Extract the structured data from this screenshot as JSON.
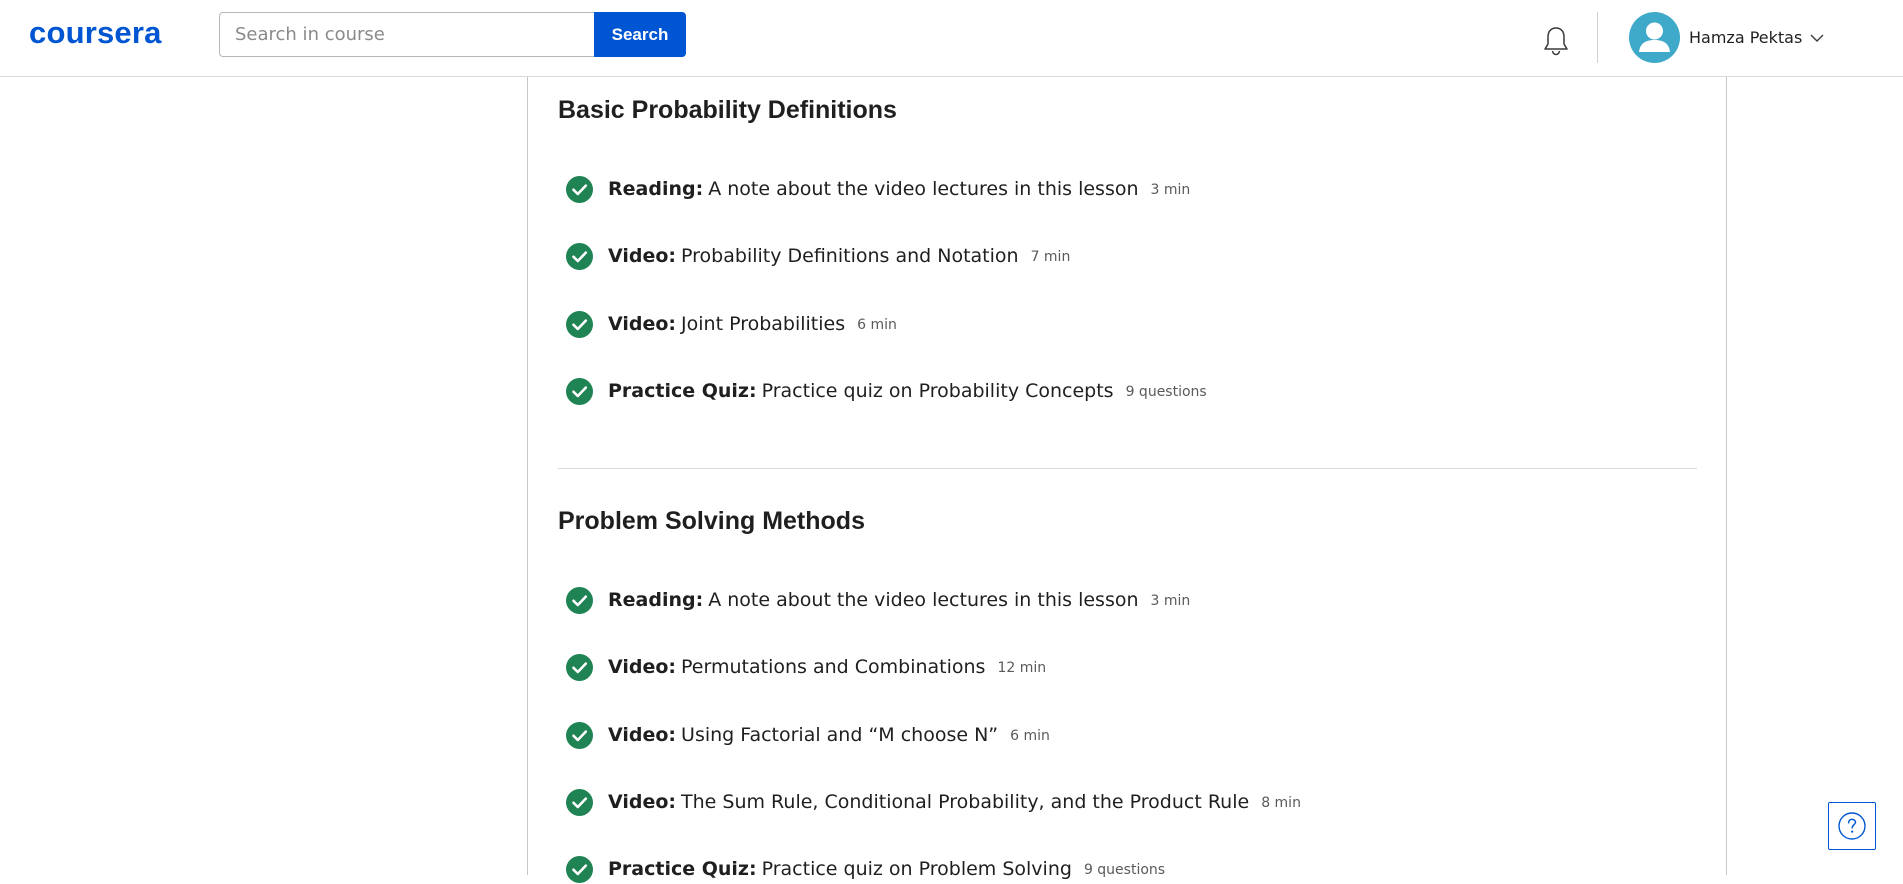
{
  "header": {
    "logo_text": "coursera",
    "search": {
      "placeholder": "Search in course",
      "value": "",
      "button_label": "Search"
    },
    "user": {
      "name": "Hamza Pektas"
    },
    "icons": {
      "notifications": "bell-icon",
      "user_menu": "chevron-down-icon",
      "avatar": "user-avatar-icon"
    }
  },
  "sections": [
    {
      "title": "Basic Probability Definitions",
      "items": [
        {
          "type": "Reading:",
          "title": "A note about the video lectures in this lesson",
          "meta": "3 min",
          "completed": true
        },
        {
          "type": "Video:",
          "title": "Probability Definitions and Notation",
          "meta": "7 min",
          "completed": true
        },
        {
          "type": "Video:",
          "title": "Joint Probabilities",
          "meta": "6 min",
          "completed": true
        },
        {
          "type": "Practice Quiz:",
          "title": "Practice quiz on Probability Concepts",
          "meta": "9 questions",
          "completed": true
        }
      ]
    },
    {
      "title": "Problem Solving Methods",
      "items": [
        {
          "type": "Reading:",
          "title": "A note about the video lectures in this lesson",
          "meta": "3 min",
          "completed": true
        },
        {
          "type": "Video:",
          "title": "Permutations and Combinations",
          "meta": "12 min",
          "completed": true
        },
        {
          "type": "Video:",
          "title": "Using Factorial and “M choose N”",
          "meta": "6 min",
          "completed": true
        },
        {
          "type": "Video:",
          "title": "The Sum Rule, Conditional Probability, and the Product Rule",
          "meta": "8 min",
          "completed": true
        },
        {
          "type": "Practice Quiz:",
          "title": "Practice quiz on Problem Solving",
          "meta": "9 questions",
          "completed": true
        }
      ]
    }
  ],
  "help": {
    "icon": "help-question-icon"
  },
  "colors": {
    "brand": "#0056d2",
    "completed": "#1f8354",
    "avatar": "#3fa9c9"
  }
}
